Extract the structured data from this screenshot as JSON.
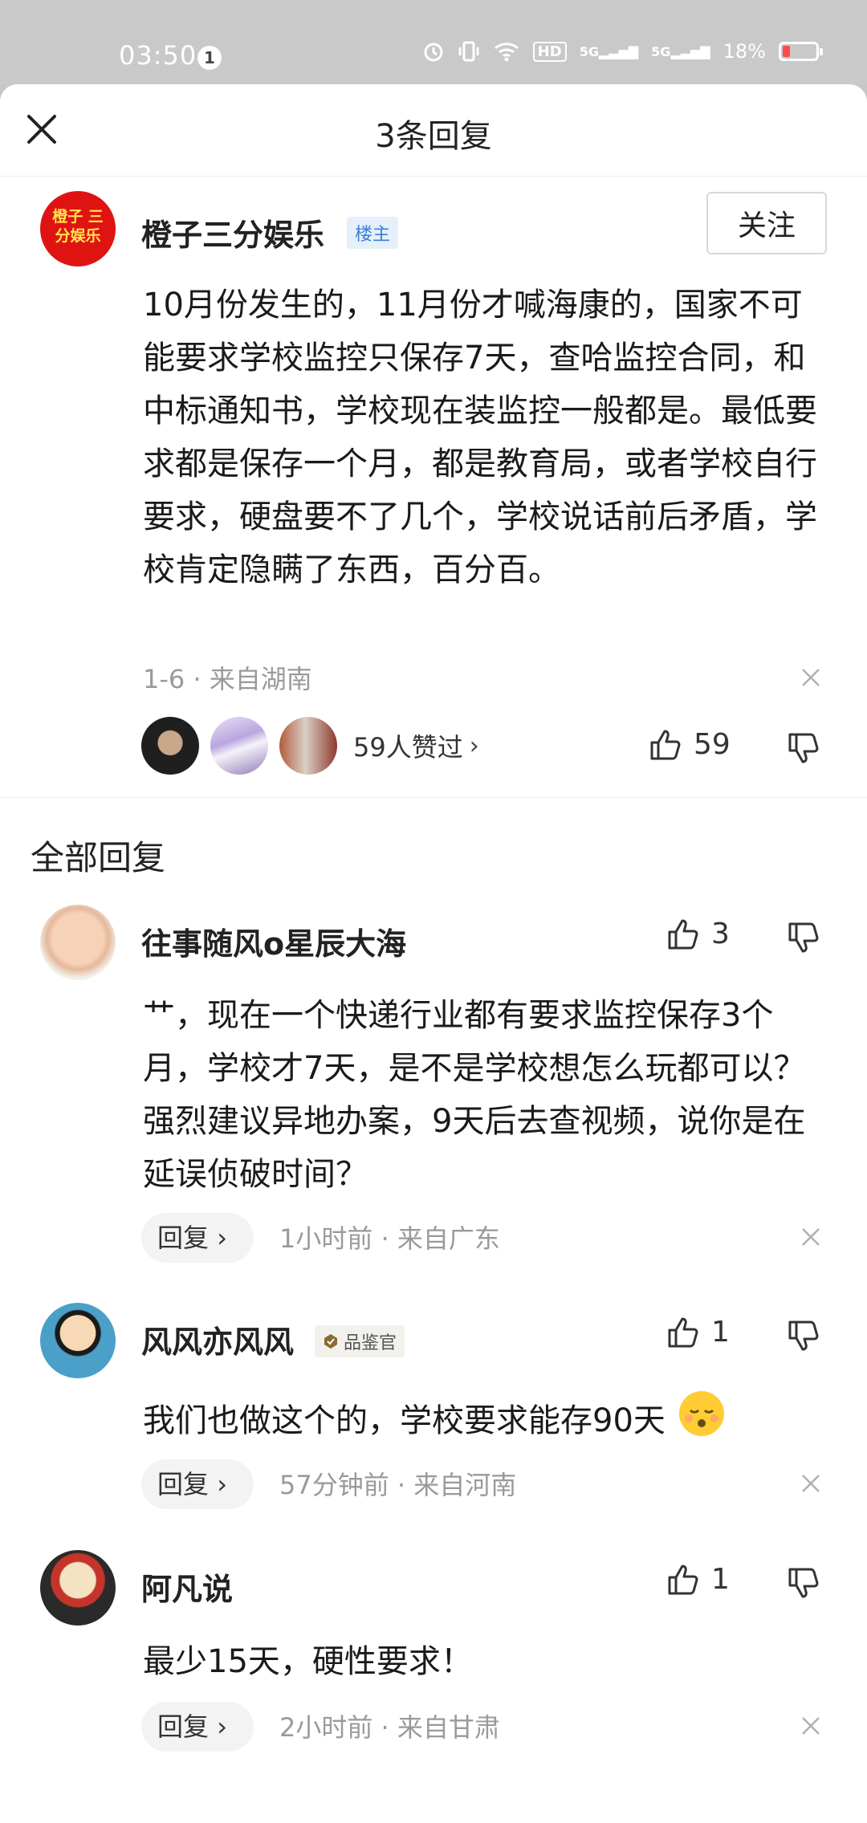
{
  "status_bar": {
    "time": "03:50",
    "notification_count": "1",
    "battery": "18%",
    "signal1": "5G",
    "signal2": "5G",
    "hd": "HD"
  },
  "header": {
    "title": "3条回复",
    "close_icon": "close-icon"
  },
  "main_post": {
    "author": "橙子三分娱乐",
    "author_avatar_text": "橙子 三分娱乐",
    "owner_tag": "楼主",
    "follow_label": "关注",
    "text": "10月份发生的，11月份才喊海康的，国家不可能要求学校监控只保存7天，查哈监控合同，和中标通知书，学校现在装监控一般都是。最低要求都是保存一个月，都是教育局，或者学校自行要求，硬盘要不了几个，学校说话前后矛盾，学校肯定隐瞒了东西，百分百。",
    "meta": "1-6 · 来自湖南",
    "likers_text": "59人赞过",
    "like_count": "59"
  },
  "section": {
    "title": "全部回复"
  },
  "replies": [
    {
      "author": "往事随风o星辰大海",
      "like_count": "3",
      "text": "艹，现在一个快递行业都有要求监控保存3个月，学校才7天，是不是学校想怎么玩都可以？强烈建议异地办案，9天后去查视频，说你是在延误侦破时间？",
      "reply_label": "回复",
      "meta": "1小时前 · 来自广东"
    },
    {
      "author": "风风亦风风",
      "badge": "品鉴官",
      "like_count": "1",
      "text": "我们也做这个的，学校要求能存90天",
      "reply_label": "回复",
      "meta": "57分钟前 · 来自河南"
    },
    {
      "author": "阿凡说",
      "like_count": "1",
      "text": "最少15天，硬性要求！",
      "reply_label": "回复",
      "meta": "2小时前 · 来自甘肃"
    }
  ],
  "colors": {
    "accent_tag_bg": "#e6f0fb",
    "accent_tag_text": "#3a7fd5",
    "meta_gray": "#9a9a9a",
    "avatar_red": "#e01313"
  }
}
